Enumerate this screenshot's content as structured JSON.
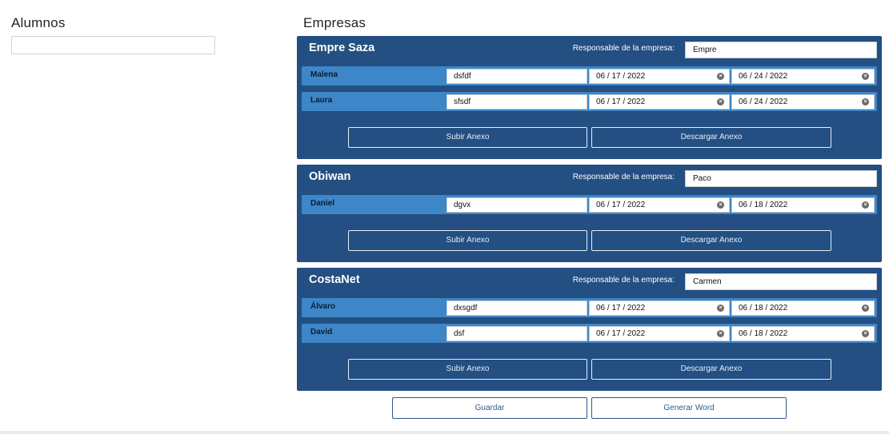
{
  "alumnos": {
    "title": "Alumnos",
    "search_value": ""
  },
  "empresas": {
    "title": "Empresas",
    "responsable_label": "Responsable de la empresa:",
    "subir_label": "Subir Anexo",
    "descargar_label": "Descargar Anexo",
    "companies": [
      {
        "name": "Empre Saza",
        "responsable": "Empre",
        "students": [
          {
            "name": "Malena",
            "text": "dsfdf",
            "date_start": "06 / 17 / 2022",
            "date_end": "06 / 24 / 2022"
          },
          {
            "name": "Laura",
            "text": "sfsdf",
            "date_start": "06 / 17 / 2022",
            "date_end": "06 / 24 / 2022"
          }
        ]
      },
      {
        "name": "Obiwan",
        "responsable": "Paco",
        "students": [
          {
            "name": "Daniel",
            "text": "dgvx",
            "date_start": "06 / 17 / 2022",
            "date_end": "06 / 18 / 2022"
          }
        ]
      },
      {
        "name": "CostaNet",
        "responsable": "Carmen",
        "students": [
          {
            "name": "Álvaro",
            "text": "dxsgdf",
            "date_start": "06 / 17 / 2022",
            "date_end": "06 / 18 / 2022"
          },
          {
            "name": "David",
            "text": "dsf",
            "date_start": "06 / 17 / 2022",
            "date_end": "06 / 18 / 2022"
          }
        ]
      }
    ]
  },
  "footer": {
    "guardar_label": "Guardar",
    "word_label": "Generar Word"
  },
  "colors": {
    "panel": "#234f82",
    "row": "#3d86c8",
    "accent": "#2a5a8c"
  }
}
